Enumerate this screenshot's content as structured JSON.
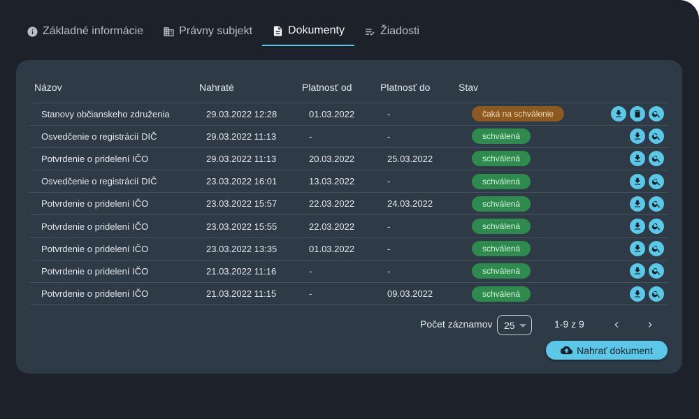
{
  "tabs": [
    {
      "label": "Základné informácie",
      "icon": "info-icon",
      "active": false
    },
    {
      "label": "Právny subjekt",
      "icon": "building-icon",
      "active": false
    },
    {
      "label": "Dokumenty",
      "icon": "document-icon",
      "active": true
    },
    {
      "label": "Žiadosti",
      "icon": "checklist-icon",
      "active": false
    }
  ],
  "table": {
    "headers": [
      "Názov",
      "Nahraté",
      "Platnosť od",
      "Platnosť do",
      "Stav"
    ],
    "rows": [
      {
        "name": "Stanovy občianskeho združenia",
        "uploaded": "29.03.2022 12:28",
        "valid_from": "01.03.2022",
        "valid_to": "-",
        "status": "čaká na schválenie",
        "status_type": "pending",
        "actions": [
          "download-icon",
          "trash-icon",
          "search-icon"
        ]
      },
      {
        "name": "Osvedčenie o registrácií DIČ",
        "uploaded": "29.03.2022 11:13",
        "valid_from": "-",
        "valid_to": "-",
        "status": "schválená",
        "status_type": "approved",
        "actions": [
          "download-icon",
          "search-icon"
        ]
      },
      {
        "name": "Potvrdenie o pridelení IČO",
        "uploaded": "29.03.2022 11:13",
        "valid_from": "20.03.2022",
        "valid_to": "25.03.2022",
        "status": "schválená",
        "status_type": "approved",
        "actions": [
          "download-icon",
          "search-icon"
        ]
      },
      {
        "name": "Osvedčenie o registrácií DIČ",
        "uploaded": "23.03.2022 16:01",
        "valid_from": "13.03.2022",
        "valid_to": "-",
        "status": "schválená",
        "status_type": "approved",
        "actions": [
          "download-icon",
          "search-icon"
        ]
      },
      {
        "name": "Potvrdenie o pridelení IČO",
        "uploaded": "23.03.2022 15:57",
        "valid_from": "22.03.2022",
        "valid_to": "24.03.2022",
        "status": "schválená",
        "status_type": "approved",
        "actions": [
          "download-icon",
          "search-icon"
        ]
      },
      {
        "name": "Potvrdenie o pridelení IČO",
        "uploaded": "23.03.2022 15:55",
        "valid_from": "22.03.2022",
        "valid_to": "-",
        "status": "schválená",
        "status_type": "approved",
        "actions": [
          "download-icon",
          "search-icon"
        ]
      },
      {
        "name": "Potvrdenie o pridelení IČO",
        "uploaded": "23.03.2022 13:35",
        "valid_from": "01.03.2022",
        "valid_to": "-",
        "status": "schválená",
        "status_type": "approved",
        "actions": [
          "download-icon",
          "search-icon"
        ]
      },
      {
        "name": "Potvrdenie o pridelení IČO",
        "uploaded": "21.03.2022 11:16",
        "valid_from": "-",
        "valid_to": "-",
        "status": "schválená",
        "status_type": "approved",
        "actions": [
          "download-icon",
          "search-icon"
        ]
      },
      {
        "name": "Potvrdenie o pridelení IČO",
        "uploaded": "21.03.2022 11:15",
        "valid_from": "-",
        "valid_to": "09.03.2022",
        "status": "schválená",
        "status_type": "approved",
        "actions": [
          "download-icon",
          "search-icon"
        ]
      }
    ]
  },
  "pagination": {
    "page_size_label": "Počet záznamov",
    "page_size": "25",
    "range": "1-9 z 9",
    "prev_icon": "chevron-left-icon",
    "next_icon": "chevron-right-icon"
  },
  "upload_button": {
    "label": "Nahrať dokument",
    "icon": "cloud-upload-icon"
  },
  "colors": {
    "background": "#1d222a",
    "card": "#2e3a46",
    "accent": "#5cc8e8",
    "approved": "#2e8b4e",
    "pending": "#8c5a21"
  }
}
